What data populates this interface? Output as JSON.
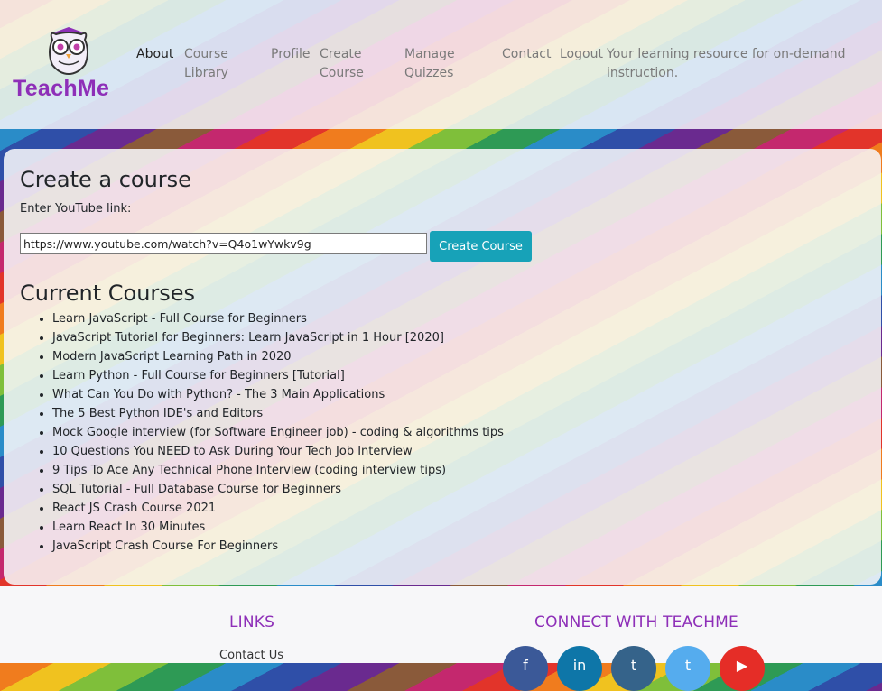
{
  "brand": {
    "name": "TeachMe",
    "logo_icon": "owl-icon"
  },
  "nav": {
    "about": "About",
    "course_library": "Course Library",
    "profile": "Profile",
    "create_course": "Create Course",
    "manage_quizzes": "Manage Quizzes",
    "contact": "Contact",
    "logout": "Logout"
  },
  "tagline": "Your learning resource for on-demand instruction.",
  "create": {
    "heading": "Create a course",
    "label": "Enter YouTube link:",
    "input_value": "https://www.youtube.com/watch?v=Q4o1wYwkv9g",
    "button": "Create Course"
  },
  "current": {
    "heading": "Current Courses",
    "items": [
      "Learn JavaScript - Full Course for Beginners",
      "JavaScript Tutorial for Beginners: Learn JavaScript in 1 Hour [2020]",
      "Modern JavaScript Learning Path in 2020",
      "Learn Python - Full Course for Beginners [Tutorial]",
      "What Can You Do with Python? - The 3 Main Applications",
      "The 5 Best Python IDE's and Editors",
      "Mock Google interview (for Software Engineer job) - coding & algorithms tips",
      "10 Questions You NEED to Ask During Your Tech Job Interview",
      "9 Tips To Ace Any Technical Phone Interview (coding interview tips)",
      "SQL Tutorial - Full Database Course for Beginners",
      "React JS Crash Course 2021",
      "Learn React In 30 Minutes",
      "JavaScript Crash Course For Beginners"
    ]
  },
  "footer": {
    "links_heading": "LINKS",
    "contact_link": "Contact Us",
    "connect_heading": "CONNECT WITH TEACHME",
    "social": [
      {
        "icon": "facebook-icon",
        "color": "#3b5998"
      },
      {
        "icon": "linkedin-icon",
        "color": "#0e76a8"
      },
      {
        "icon": "tumblr-icon",
        "color": "#35638a"
      },
      {
        "icon": "twitter-icon",
        "color": "#55acee"
      },
      {
        "icon": "youtube-icon",
        "color": "#e52d27"
      }
    ]
  },
  "colors": {
    "brand": "#8e2fb8",
    "button": "#17a2b8"
  }
}
